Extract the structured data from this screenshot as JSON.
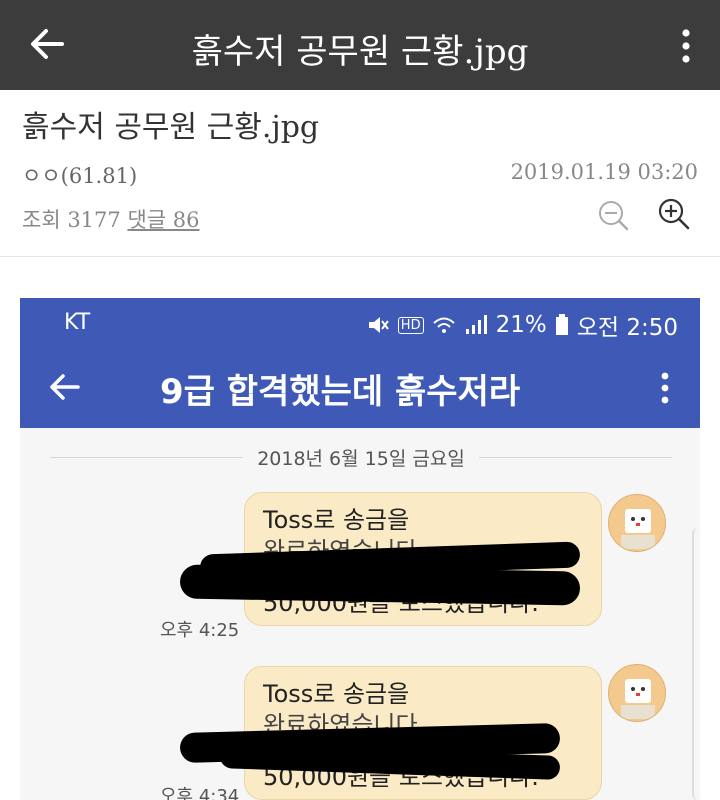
{
  "appbar": {
    "title": "흙수저 공무원 근황.jpg"
  },
  "post": {
    "title": "흙수저 공무원 근황.jpg",
    "author": "ㅇㅇ(61.81)",
    "date": "2019.01.19 03:20",
    "views_label": "조회 3177",
    "comments_label": "댓글 86"
  },
  "screenshot": {
    "carrier": "KT",
    "hd": "HD",
    "battery": "21%",
    "clock": "오전 2:50",
    "chat_title": "9급 합격했는데 흙수저라",
    "date_separator": "2018년 6월 15일 금요일",
    "messages": [
      {
        "line1": "Toss로 송금을",
        "line2": "완료하였습니다",
        "line3": "50,000원을 토스했습니다.",
        "time": "오후 4:25"
      },
      {
        "line1": "Toss로 송금을",
        "line2": "완료하였습니다",
        "line3": "50,000원을 토스했습니다.",
        "time": "오후 4:34"
      }
    ]
  },
  "colors": {
    "appbar": "#3c3c3c",
    "chat_header": "#3e5ab6",
    "bubble": "#faebc6"
  },
  "icons": [
    "back-arrow-icon",
    "more-vert-icon",
    "zoom-out-icon",
    "zoom-in-icon",
    "mute-icon",
    "wifi-icon",
    "signal-icon",
    "battery-icon"
  ]
}
